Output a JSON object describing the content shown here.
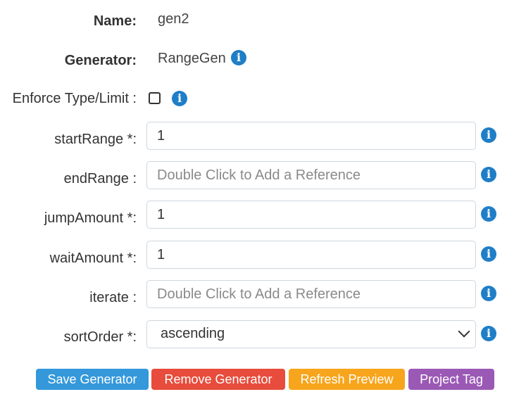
{
  "name": {
    "label": "Name:",
    "value": "gen2"
  },
  "generator": {
    "label": "Generator:",
    "value": "RangeGen"
  },
  "enforce": {
    "label": "Enforce Type/Limit :",
    "checked": false
  },
  "fields": {
    "startRange": {
      "label": "startRange *:",
      "value": "1",
      "placeholder": ""
    },
    "endRange": {
      "label": "endRange :",
      "value": "",
      "placeholder": "Double Click to Add a Reference"
    },
    "jumpAmount": {
      "label": "jumpAmount *:",
      "value": "1",
      "placeholder": ""
    },
    "waitAmount": {
      "label": "waitAmount *:",
      "value": "1",
      "placeholder": ""
    },
    "iterate": {
      "label": "iterate :",
      "value": "",
      "placeholder": "Double Click to Add a Reference"
    },
    "sortOrder": {
      "label": "sortOrder *:",
      "value": "ascending"
    }
  },
  "info_glyph": "i",
  "buttons": {
    "save": {
      "label": "Save Generator",
      "color": "#3498db"
    },
    "remove": {
      "label": "Remove Generator",
      "color": "#e74c3c"
    },
    "refresh": {
      "label": "Refresh Preview",
      "color": "#f7a51c"
    },
    "tag": {
      "label": "Project Tag",
      "color": "#9b59b6"
    }
  },
  "colors": {
    "info": "#1f7ec7",
    "field_border": "#cfd6dd"
  }
}
